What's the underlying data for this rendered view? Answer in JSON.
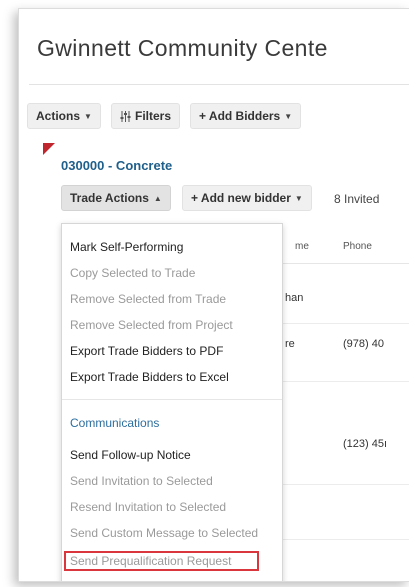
{
  "page": {
    "title": "Gwinnett Community Cente"
  },
  "toolbar": {
    "actions_label": "Actions",
    "filters_label": "Filters",
    "add_bidders_label": "+ Add Bidders"
  },
  "trade": {
    "name": "030000 - Concrete",
    "trade_actions_label": "Trade Actions",
    "add_new_bidder_label": "+ Add new bidder",
    "invited_count": "8 Invited"
  },
  "table": {
    "headers": [
      "me",
      "Phone"
    ],
    "rows": [
      {
        "name": "han",
        "phone": ""
      },
      {
        "name": "re",
        "phone": "(978) 40"
      },
      {
        "name": "",
        "phone": "(123) 45ı"
      }
    ]
  },
  "menu": {
    "items": [
      {
        "label": "Mark Self-Performing",
        "enabled": true
      },
      {
        "label": "Copy Selected to Trade",
        "enabled": false
      },
      {
        "label": "Remove Selected from Trade",
        "enabled": false
      },
      {
        "label": "Remove Selected from Project",
        "enabled": false
      },
      {
        "label": "Export Trade Bidders to PDF",
        "enabled": true
      },
      {
        "label": "Export Trade Bidders to Excel",
        "enabled": true
      }
    ],
    "communications_heading": "Communications",
    "communications": [
      {
        "label": "Send Follow-up Notice",
        "enabled": true
      },
      {
        "label": "Send Invitation to Selected",
        "enabled": false
      },
      {
        "label": "Resend Invitation to Selected",
        "enabled": false
      },
      {
        "label": "Send Custom Message to Selected",
        "enabled": false
      },
      {
        "label": "Send Prequalification Request",
        "enabled": false,
        "highlighted": true
      }
    ]
  },
  "colors": {
    "accent": "#1f5f8b",
    "flag": "#c0262d",
    "highlight": "#d9363e"
  },
  "icons": [
    "caret-down-icon",
    "caret-up-icon",
    "filter-icon"
  ]
}
